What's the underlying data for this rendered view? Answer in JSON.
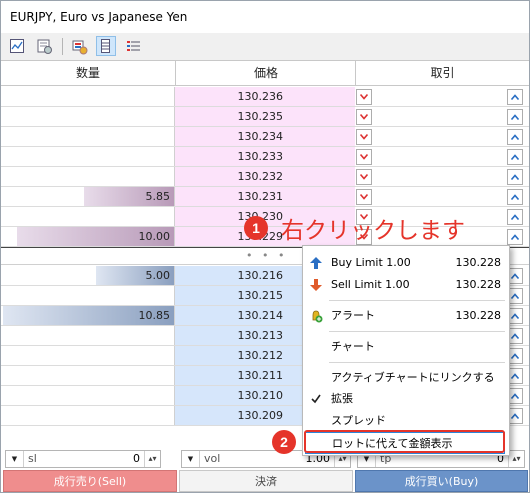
{
  "window": {
    "title": "EURJPY, Euro vs Japanese Yen"
  },
  "toolbar": {
    "icons": [
      "chart-icon",
      "settings-icon",
      "depth-icon",
      "calendar-icon",
      "list-icon"
    ],
    "active_index": 3
  },
  "columns": {
    "volume": "数量",
    "price": "価格",
    "trade": "取引"
  },
  "colors": {
    "ask_bg": "#fce3fa",
    "bid_bg": "#d6e6fb",
    "sell": "#ef8d8d",
    "buy": "#6b93c9",
    "annotation": "#e5342a"
  },
  "ask_rows": [
    {
      "volume": "",
      "price": "130.236",
      "depth": 0
    },
    {
      "volume": "",
      "price": "130.235",
      "depth": 0
    },
    {
      "volume": "",
      "price": "130.234",
      "depth": 0
    },
    {
      "volume": "",
      "price": "130.233",
      "depth": 0
    },
    {
      "volume": "",
      "price": "130.232",
      "depth": 0
    },
    {
      "volume": "5.85",
      "price": "130.231",
      "depth": 0.52
    },
    {
      "volume": "",
      "price": "130.230",
      "depth": 0
    },
    {
      "volume": "10.00",
      "price": "130.229",
      "depth": 0.9
    }
  ],
  "separator": {
    "dots": "• • •"
  },
  "bid_rows": [
    {
      "volume": "5.00",
      "price": "130.216",
      "depth": 0.45
    },
    {
      "volume": "",
      "price": "130.215",
      "depth": 0
    },
    {
      "volume": "10.85",
      "price": "130.214",
      "depth": 0.98
    },
    {
      "volume": "",
      "price": "130.213",
      "depth": 0
    },
    {
      "volume": "",
      "price": "130.212",
      "depth": 0
    },
    {
      "volume": "",
      "price": "130.211",
      "depth": 0
    },
    {
      "volume": "",
      "price": "130.210",
      "depth": 0
    },
    {
      "volume": "",
      "price": "130.209",
      "depth": 0
    }
  ],
  "inputs": {
    "sl": {
      "label": "sl",
      "value": "0"
    },
    "vol": {
      "label": "vol",
      "value": "1.00"
    },
    "tp": {
      "label": "tp",
      "value": "0"
    }
  },
  "buttons": {
    "sell": "成行売り(Sell)",
    "close": "決済",
    "buy": "成行買い(Buy)"
  },
  "context_menu": {
    "buy_limit": {
      "label": "Buy Limit 1.00",
      "price": "130.228"
    },
    "sell_limit": {
      "label": "Sell Limit 1.00",
      "price": "130.228"
    },
    "alert": {
      "label": "アラート",
      "price": "130.228"
    },
    "chart": "チャート",
    "link_chart": "アクティブチャートにリンクする",
    "expand": "拡張",
    "spread": "スプレッド",
    "lot_to_amount": "ロットに代えて金額表示"
  },
  "annotations": {
    "step1_number": "1",
    "step1_text": "右クリックします",
    "step2_number": "2"
  }
}
